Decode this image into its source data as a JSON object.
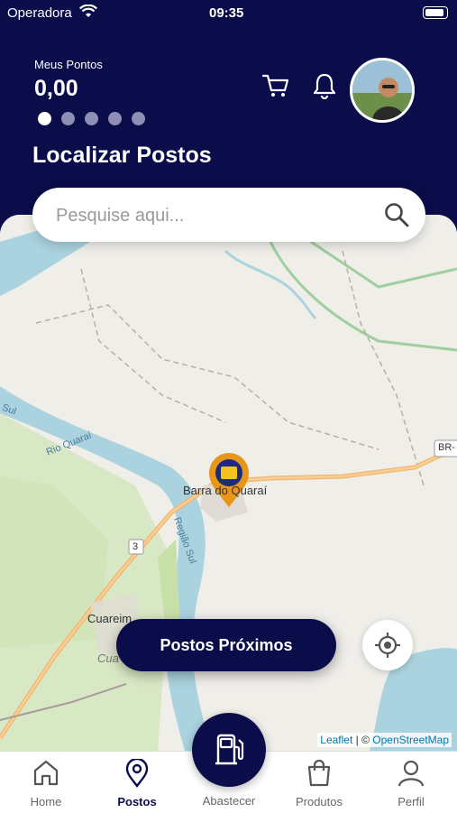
{
  "status_bar": {
    "carrier": "Operadora",
    "time": "09:35"
  },
  "header": {
    "points_label": "Meus Pontos",
    "points_value": "0,00",
    "carousel_dots": 5,
    "active_dot": 0,
    "cart_icon": "cart-icon",
    "bell_icon": "bell-icon"
  },
  "page_title": "Localizar Postos",
  "search": {
    "placeholder": "Pesquise aqui..."
  },
  "map": {
    "labels": {
      "city_main": "Barra do Quaraí",
      "city_secondary": "Cuareim",
      "river_1": "Rio Quaraí",
      "river_2": "Região Sul",
      "route": "3",
      "highway": "BR-",
      "sul_label": "Sul",
      "cua": "Cua"
    },
    "attribution_leaflet": "Leaflet",
    "attribution_sep": " | © ",
    "attribution_osm": "OpenStreetMap"
  },
  "nearby_button": "Postos Próximos",
  "tabs": [
    {
      "label": "Home",
      "icon": "home-icon"
    },
    {
      "label": "Postos",
      "icon": "map-pin-icon"
    },
    {
      "label": "Abastecer",
      "icon": "fuel-pump-icon"
    },
    {
      "label": "Produtos",
      "icon": "shopping-bag-icon"
    },
    {
      "label": "Perfil",
      "icon": "user-icon"
    }
  ],
  "colors": {
    "primary": "#0b0c4a",
    "map_bg": "#f0eee9",
    "water": "#aad3df",
    "pin": "#e8961a"
  }
}
